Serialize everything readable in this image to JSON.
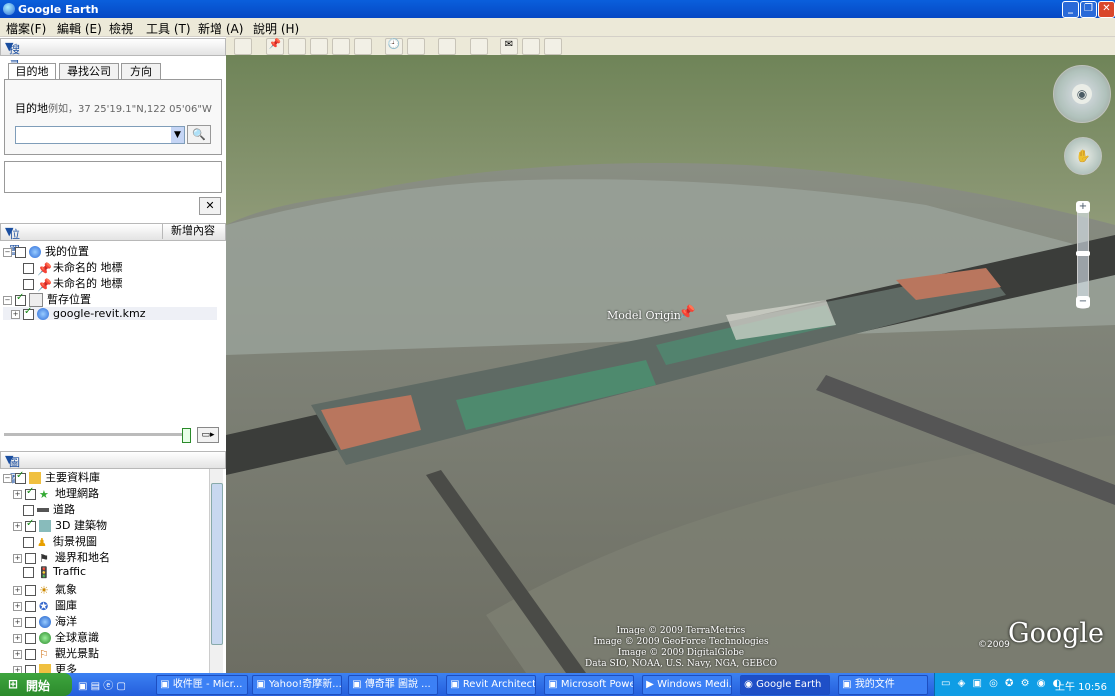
{
  "window": {
    "title": "Google Earth"
  },
  "menu": [
    "檔案(F)",
    "編輯 (E)",
    "檢視",
    "工具 (T)",
    "新增 (A)",
    "說明 (H)"
  ],
  "search": {
    "header": "搜尋",
    "tabs": [
      "目的地",
      "尋找公司",
      "方向"
    ],
    "label": "目的地",
    "hint": "例如，37 25'19.1\"N,122 05'06\"W"
  },
  "places": {
    "header": "位置",
    "add_button": "新增內容",
    "items": [
      {
        "label": "我的位置"
      },
      {
        "label": "未命名的 地標"
      },
      {
        "label": "未命名的 地標"
      },
      {
        "label": "暫存位置"
      },
      {
        "label": "google-revit.kmz"
      }
    ]
  },
  "layers": {
    "header": "圖層",
    "items": [
      {
        "label": "主要資料庫"
      },
      {
        "label": "地理網路"
      },
      {
        "label": "道路"
      },
      {
        "label": "3D 建築物"
      },
      {
        "label": "街景視圖"
      },
      {
        "label": "邊界和地名"
      },
      {
        "label": "Traffic"
      },
      {
        "label": "氣象"
      },
      {
        "label": "圖庫"
      },
      {
        "label": "海洋"
      },
      {
        "label": "全球意識"
      },
      {
        "label": "觀光景點"
      },
      {
        "label": "更多"
      }
    ]
  },
  "map": {
    "placemark_label": "Model Origin",
    "attribution": [
      "Image © 2009 TerraMetrics",
      "Image © 2009 GeoForce Technologies",
      "Image © 2009 DigitalGlobe",
      "Data SIO, NOAA, U.S. Navy, NGA, GEBCO"
    ],
    "year": "©2009",
    "logo": "Google"
  },
  "taskbar": {
    "start": "開始",
    "items": [
      "收件匣 - Micr...",
      "Yahoo!奇摩新...",
      "傳奇罪 圖說 ...",
      "Revit Architect...",
      "Microsoft Powe...",
      "Windows Medi...",
      "Google Earth",
      "我的文件"
    ],
    "clock": "上午 10:56"
  }
}
